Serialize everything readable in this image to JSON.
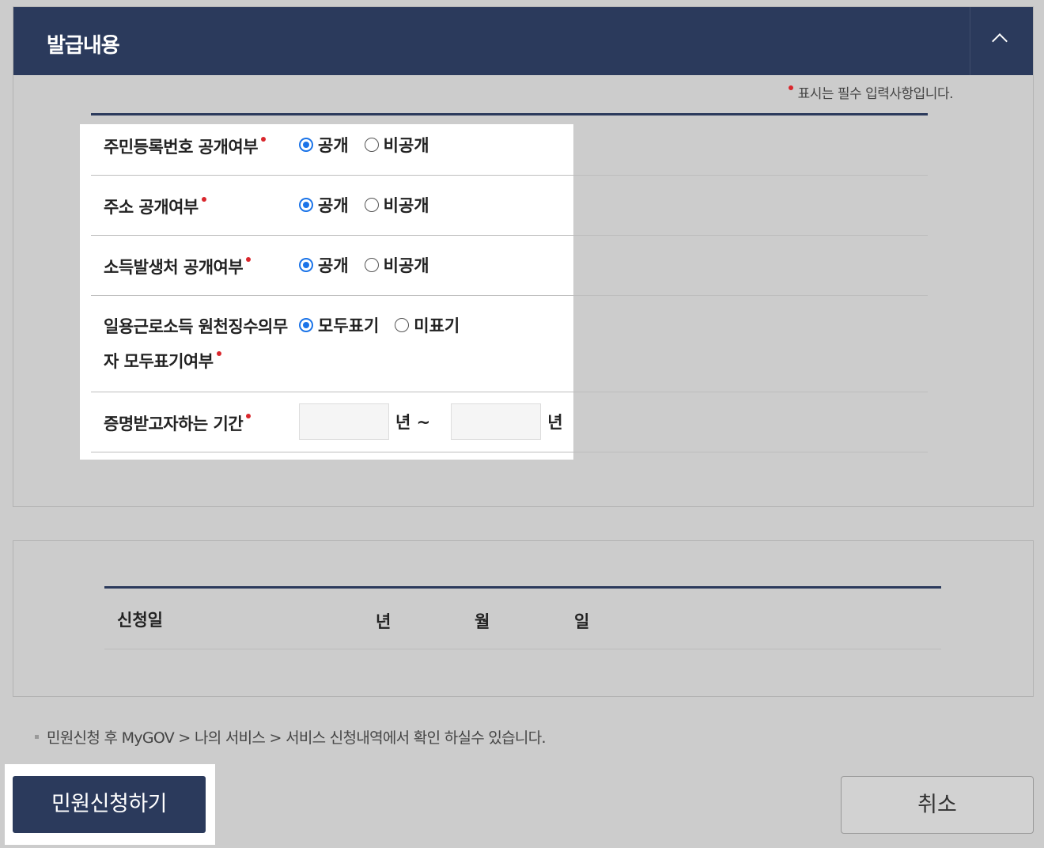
{
  "section_title": "발급내용",
  "required_note": "표시는 필수 입력사항입니다.",
  "rows": [
    {
      "label": "주민등록번호 공개여부",
      "options": [
        "공개",
        "비공개"
      ],
      "selected": 0
    },
    {
      "label": "주소 공개여부",
      "options": [
        "공개",
        "비공개"
      ],
      "selected": 0
    },
    {
      "label": "소득발생처 공개여부",
      "options": [
        "공개",
        "비공개"
      ],
      "selected": 0
    },
    {
      "label_line1": "일용근로소득 원천징수의무",
      "label_line2": "자 모두표기여부",
      "options": [
        "모두표기",
        "미표기"
      ],
      "selected": 0
    },
    {
      "label": "증명받고자하는 기간",
      "from_value": "",
      "to_value": "",
      "unit_from": "년 ~",
      "unit_to": "년"
    }
  ],
  "application_date": {
    "label": "신청일",
    "year": "년",
    "month": "월",
    "day": "일"
  },
  "notice": "민원신청 후 MyGOV > 나의 서비스 > 서비스 신청내역에서 확인 하실수 있습니다.",
  "buttons": {
    "submit": "민원신청하기",
    "cancel": "취소"
  },
  "colors": {
    "header": "#2b3a5c",
    "required": "#d9262c",
    "radio": "#1a73e8"
  }
}
